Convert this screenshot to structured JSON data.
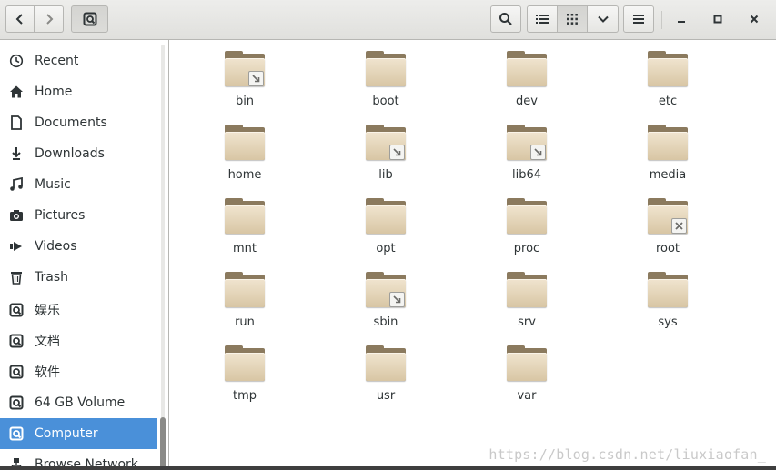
{
  "toolbar": {
    "back_icon": "chevron-left-icon",
    "forward_icon": "chevron-right-icon",
    "location_icon": "drive-icon",
    "search_icon": "search-icon",
    "list_view_icon": "list-view-icon",
    "grid_view_icon": "grid-view-icon",
    "view_options_icon": "chevron-down-icon",
    "menu_icon": "hamburger-menu-icon",
    "minimize_icon": "minimize-icon",
    "maximize_icon": "maximize-icon",
    "close_icon": "close-icon"
  },
  "sidebar": {
    "places": [
      {
        "label": "Recent",
        "icon": "clock-icon"
      },
      {
        "label": "Home",
        "icon": "home-icon"
      },
      {
        "label": "Documents",
        "icon": "document-icon"
      },
      {
        "label": "Downloads",
        "icon": "download-icon"
      },
      {
        "label": "Music",
        "icon": "music-icon"
      },
      {
        "label": "Pictures",
        "icon": "camera-icon"
      },
      {
        "label": "Videos",
        "icon": "video-icon"
      },
      {
        "label": "Trash",
        "icon": "trash-icon"
      }
    ],
    "devices": [
      {
        "label": "娱乐",
        "icon": "drive-icon"
      },
      {
        "label": "文档",
        "icon": "drive-icon"
      },
      {
        "label": "软件",
        "icon": "drive-icon"
      },
      {
        "label": "64 GB Volume",
        "icon": "drive-icon"
      },
      {
        "label": "Computer",
        "icon": "drive-icon",
        "selected": true
      },
      {
        "label": "Browse Network",
        "icon": "network-icon"
      }
    ],
    "selected_color": "#4a90d9"
  },
  "files": [
    {
      "name": "bin",
      "emblem": "symlink"
    },
    {
      "name": "boot",
      "emblem": ""
    },
    {
      "name": "dev",
      "emblem": ""
    },
    {
      "name": "etc",
      "emblem": ""
    },
    {
      "name": "home",
      "emblem": ""
    },
    {
      "name": "lib",
      "emblem": "symlink"
    },
    {
      "name": "lib64",
      "emblem": "symlink"
    },
    {
      "name": "media",
      "emblem": ""
    },
    {
      "name": "mnt",
      "emblem": ""
    },
    {
      "name": "opt",
      "emblem": ""
    },
    {
      "name": "proc",
      "emblem": ""
    },
    {
      "name": "root",
      "emblem": "unreadable"
    },
    {
      "name": "run",
      "emblem": ""
    },
    {
      "name": "sbin",
      "emblem": "symlink"
    },
    {
      "name": "srv",
      "emblem": ""
    },
    {
      "name": "sys",
      "emblem": ""
    },
    {
      "name": "tmp",
      "emblem": ""
    },
    {
      "name": "usr",
      "emblem": ""
    },
    {
      "name": "var",
      "emblem": ""
    }
  ],
  "watermark": "https://blog.csdn.net/liuxiaofan_",
  "colors": {
    "folder_front": "#e6d7bb",
    "folder_back": "#8b7a5e",
    "accent": "#4a90d9"
  }
}
